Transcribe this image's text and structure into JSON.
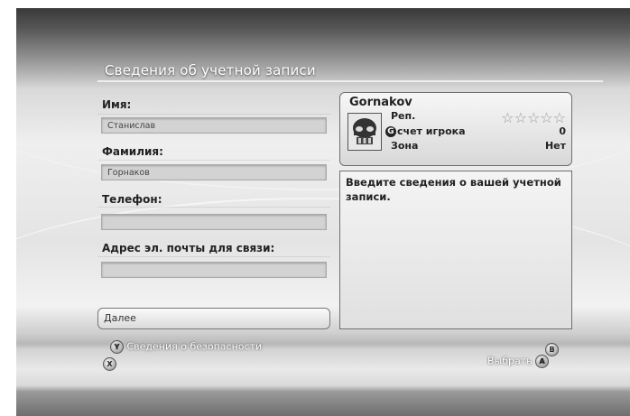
{
  "screen": {
    "title": "Сведения об учетной записи"
  },
  "form": {
    "first_name": {
      "label": "Имя:",
      "value": "Станислав"
    },
    "last_name": {
      "label": "Фамилия:",
      "value": "Горнаков"
    },
    "phone": {
      "label": "Телефон:",
      "value": ""
    },
    "email": {
      "label": "Адрес эл. почты для связи:",
      "value": ""
    },
    "next_label": "Далее"
  },
  "profile": {
    "gamertag": "Gornakov",
    "rep_label": "Реп.",
    "rep_stars": 0,
    "score_label": "счет игрока",
    "score_icon": "G",
    "score_value": "0",
    "zone_label": "Зона",
    "zone_value": "Нет"
  },
  "info": {
    "text": "Введите сведения о вашей учетной записи."
  },
  "footer": {
    "security_label": "Сведения о безопасности",
    "y_glyph": "Y",
    "x_glyph": "X",
    "b_glyph": "B",
    "a_glyph": "A",
    "select_label": "Выбрать"
  },
  "icons": {
    "avatar": "skull-avatar-icon",
    "star": "star-outline-icon"
  }
}
